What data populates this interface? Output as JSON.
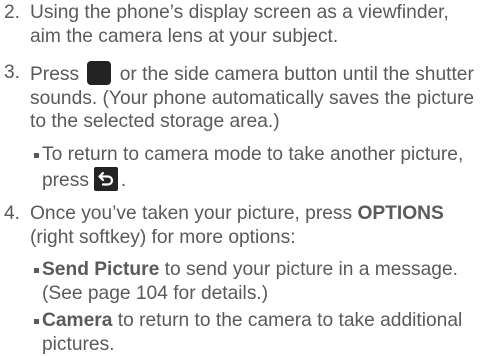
{
  "steps": [
    {
      "number": "2.",
      "text": "Using the phone’s display screen as a viewfinder, aim the camera lens at your subject."
    },
    {
      "number": "3.",
      "text_before_icon": "Press",
      "text_after_icon": "or the side camera button until the shutter sounds. (Your phone automatically saves the picture to the selected storage area.)",
      "bullets": [
        {
          "text_before_icon": "To return to camera mode to take another picture, press",
          "text_after_icon": "."
        }
      ]
    },
    {
      "number": "4.",
      "text_before_bold": "Once you’ve taken your picture, press",
      "bold": "OPTIONS",
      "text_after_bold": "(right softkey) for more options:",
      "bullets": [
        {
          "bold": "Send Picture",
          "text": "to send your picture in a message. (See page 104 for details.)"
        },
        {
          "bold": "Camera",
          "text": "to return to the camera to take additional pictures."
        }
      ]
    }
  ],
  "icons": {
    "camera_key": "camera-key-icon",
    "back": "back-icon"
  }
}
